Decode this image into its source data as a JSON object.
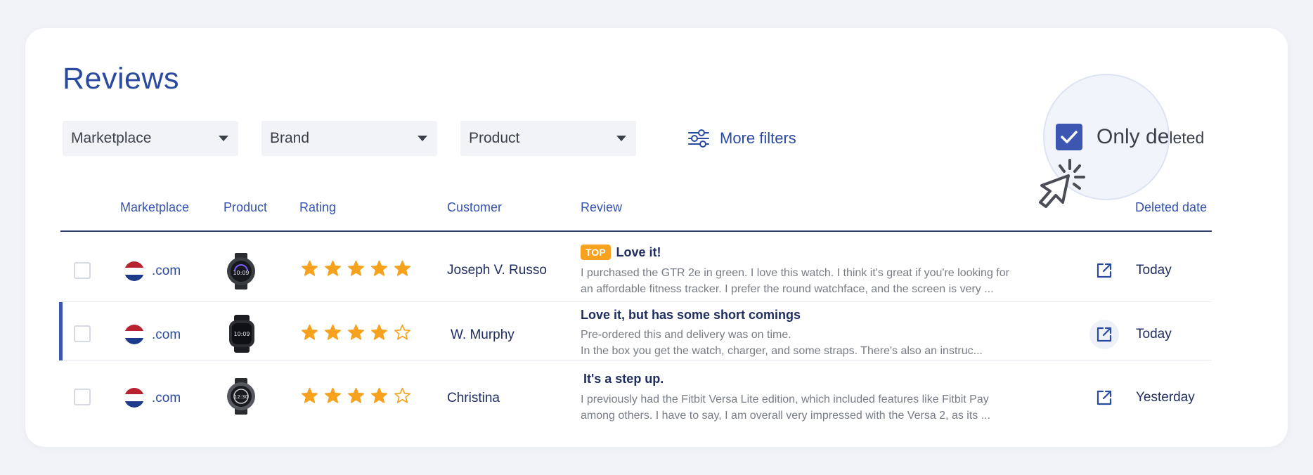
{
  "page": {
    "title": "Reviews"
  },
  "filters": {
    "marketplace": "Marketplace",
    "brand": "Brand",
    "product": "Product",
    "more_filters": "More filters",
    "only_deleted_main": "Only de",
    "only_deleted_tail": "leted",
    "only_deleted_checked": true
  },
  "table": {
    "headers": {
      "marketplace": "Marketplace",
      "product": "Product",
      "rating": "Rating",
      "customer": "Customer",
      "review": "Review",
      "deleted_date": "Deleted date"
    },
    "rows": [
      {
        "marketplace": ".com",
        "rating": 5,
        "customer": "Joseph V. Russo",
        "badge": "TOP",
        "review_title": "Love it!",
        "review_line1": "I purchased the GTR 2e in green. I love this watch. I think it's great if you're looking for",
        "review_line2": "an affordable fitness tracker. I prefer the round watchface, and the screen is very ...",
        "deleted_date": "Today"
      },
      {
        "marketplace": ".com",
        "rating": 4,
        "customer": "W. Murphy",
        "review_title": "Love it, but has some short comings",
        "review_line1": "Pre-ordered this and delivery was on time.",
        "review_line2": "In the box you get the watch, charger, and some straps. There's also an instruc...",
        "deleted_date": "Today"
      },
      {
        "marketplace": ".com",
        "rating": 4,
        "customer": "Christina",
        "review_title": "It's a step up.",
        "review_line1": "I previously had the Fitbit Versa Lite edition, which included features like Fitbit Pay",
        "review_line2": "among others. I have to say, I am overall very impressed with the Versa 2, as its ...",
        "deleted_date": "Yesterday"
      }
    ]
  },
  "colors": {
    "accent": "#3d56b2",
    "star": "#f6a21e",
    "badge": "#f6a21e",
    "flag_red": "#b8212f",
    "flag_blue": "#1e3a8a"
  },
  "icons": {
    "dropdown": "chevron-down-icon",
    "more_filters": "sliders-icon",
    "checkbox": "checkmark-icon",
    "cursor": "click-cursor-icon",
    "star": "star-icon",
    "open": "external-link-icon"
  }
}
